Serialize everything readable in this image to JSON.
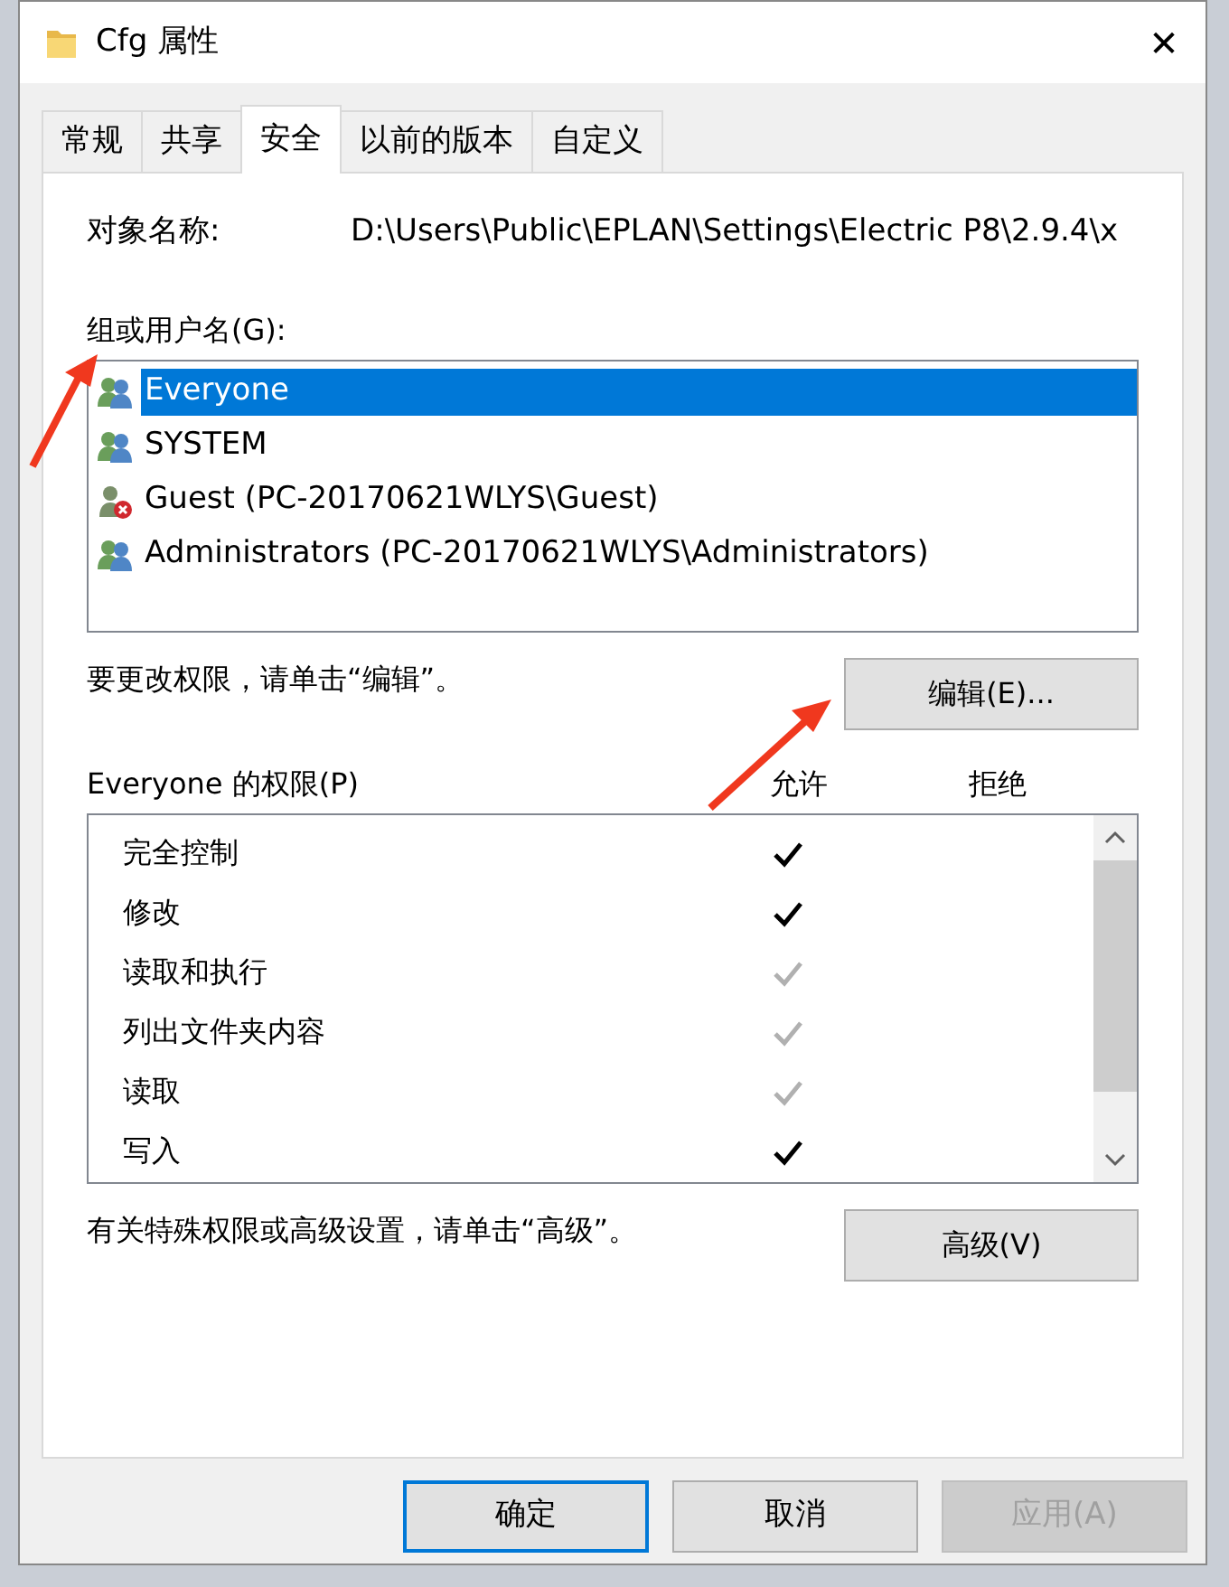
{
  "window": {
    "title": "Cfg 属性",
    "close": "✕"
  },
  "tabs": [
    {
      "label": "常规",
      "selected": false
    },
    {
      "label": "共享",
      "selected": false
    },
    {
      "label": "安全",
      "selected": true
    },
    {
      "label": "以前的版本",
      "selected": false
    },
    {
      "label": "自定义",
      "selected": false
    }
  ],
  "object_name": {
    "label": "对象名称:",
    "value": "D:\\Users\\Public\\EPLAN\\Settings\\Electric P8\\2.9.4\\x"
  },
  "principals": {
    "label": "组或用户名(G):",
    "items": [
      {
        "name": "Everyone",
        "kind": "group",
        "selected": true
      },
      {
        "name": "SYSTEM",
        "kind": "group",
        "selected": false
      },
      {
        "name": "Guest (PC-20170621WLYS\\Guest)",
        "kind": "disabled_user",
        "selected": false
      },
      {
        "name": "Administrators (PC-20170621WLYS\\Administrators)",
        "kind": "group",
        "selected": false
      }
    ]
  },
  "edit_hint": "要更改权限，请单击“编辑”。",
  "edit_button": "编辑(E)...",
  "permissions": {
    "label": "Everyone 的权限(P)",
    "allow_header": "允许",
    "deny_header": "拒绝",
    "rows": [
      {
        "name": "完全控制",
        "allow": true,
        "inherited": false,
        "deny": false
      },
      {
        "name": "修改",
        "allow": true,
        "inherited": false,
        "deny": false
      },
      {
        "name": "读取和执行",
        "allow": true,
        "inherited": true,
        "deny": false
      },
      {
        "name": "列出文件夹内容",
        "allow": true,
        "inherited": true,
        "deny": false
      },
      {
        "name": "读取",
        "allow": true,
        "inherited": true,
        "deny": false
      },
      {
        "name": "写入",
        "allow": true,
        "inherited": false,
        "deny": false
      }
    ]
  },
  "advanced_hint": "有关特殊权限或高级设置，请单击“高级”。",
  "advanced_button": "高级(V)",
  "buttons": [
    {
      "label": "确定",
      "default": true,
      "disabled": false
    },
    {
      "label": "取消",
      "default": false,
      "disabled": false
    },
    {
      "label": "应用(A)",
      "default": false,
      "disabled": true
    }
  ],
  "annotations": [
    {
      "kind": "arrow"
    },
    {
      "kind": "arrow"
    }
  ]
}
